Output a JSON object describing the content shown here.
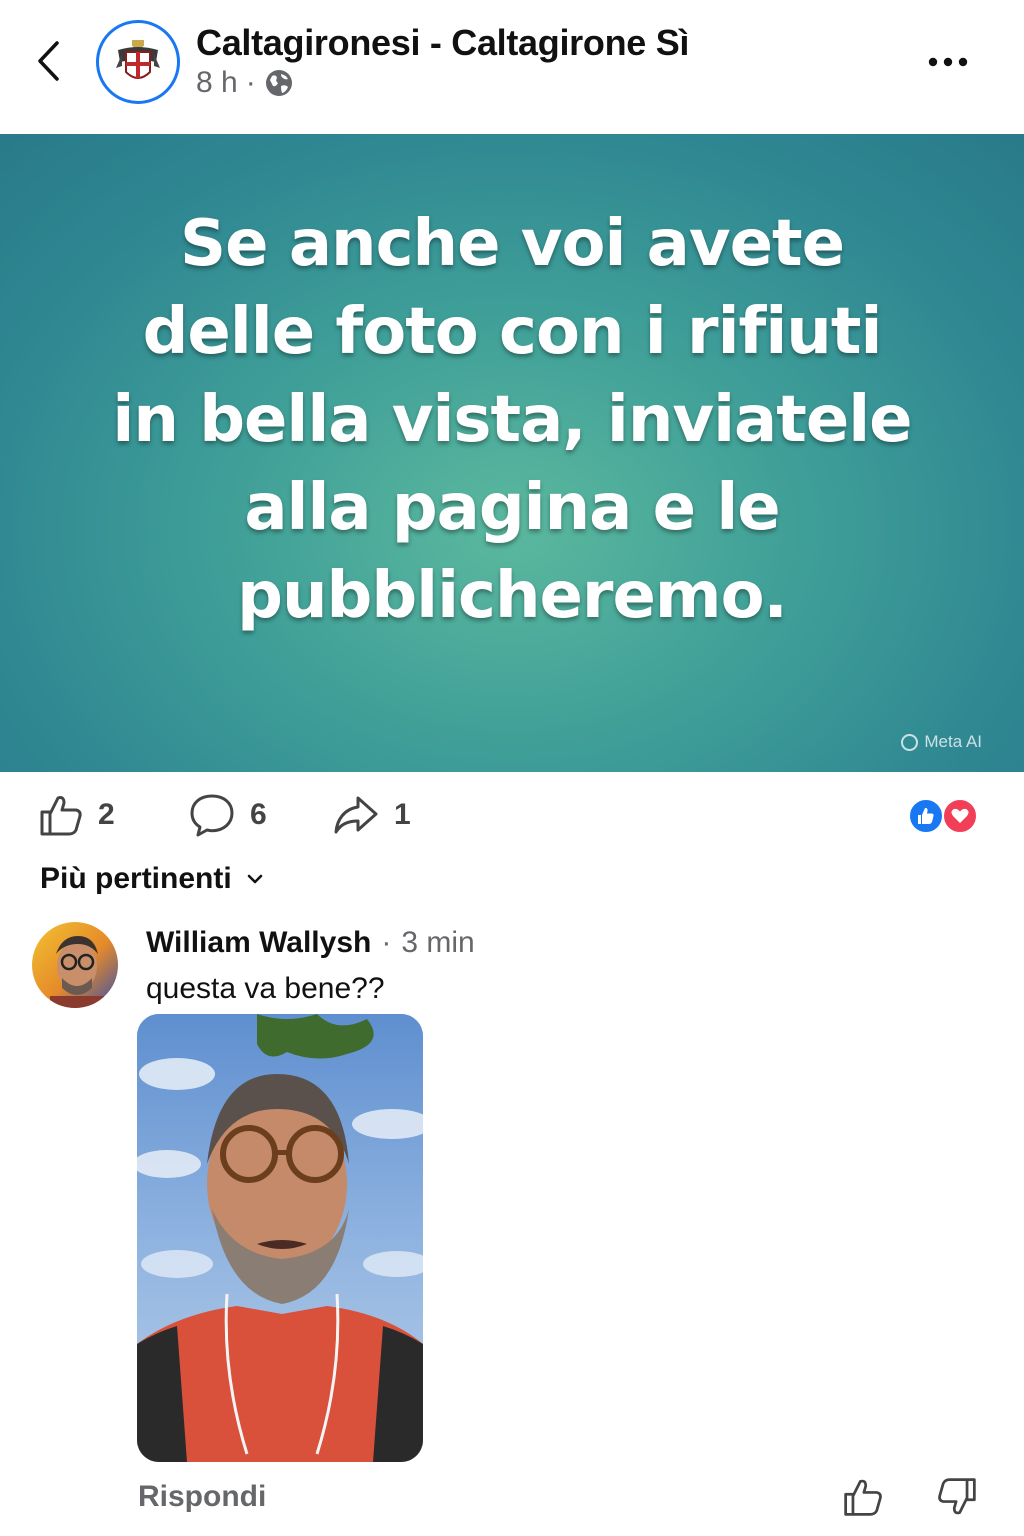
{
  "header": {
    "page_name": "Caltagironesi - Caltagirone Sì",
    "time": "8 h",
    "separator": "·",
    "icons": {
      "back": "chevron-left-icon",
      "audience": "globe-icon",
      "more": "more-horizontal-icon"
    }
  },
  "post": {
    "text": "Se anche voi avete delle foto con i rifiuti in bella vista, inviatele alla pagina e le pubblicheremo.",
    "watermark": "Meta AI",
    "background_colors": [
      "#5bb89e",
      "#2a7b8a"
    ]
  },
  "actions": {
    "likes": "2",
    "comments": "6",
    "shares": "1",
    "reaction_types": [
      "like",
      "love"
    ],
    "colors": {
      "like": "#1877f2",
      "love": "#f33e58"
    }
  },
  "sort": {
    "label": "Più pertinenti"
  },
  "comment": {
    "author": "William Wallysh",
    "separator": "·",
    "time": "3 min",
    "text": "questa va bene??",
    "reply_label": "Rispondi"
  }
}
